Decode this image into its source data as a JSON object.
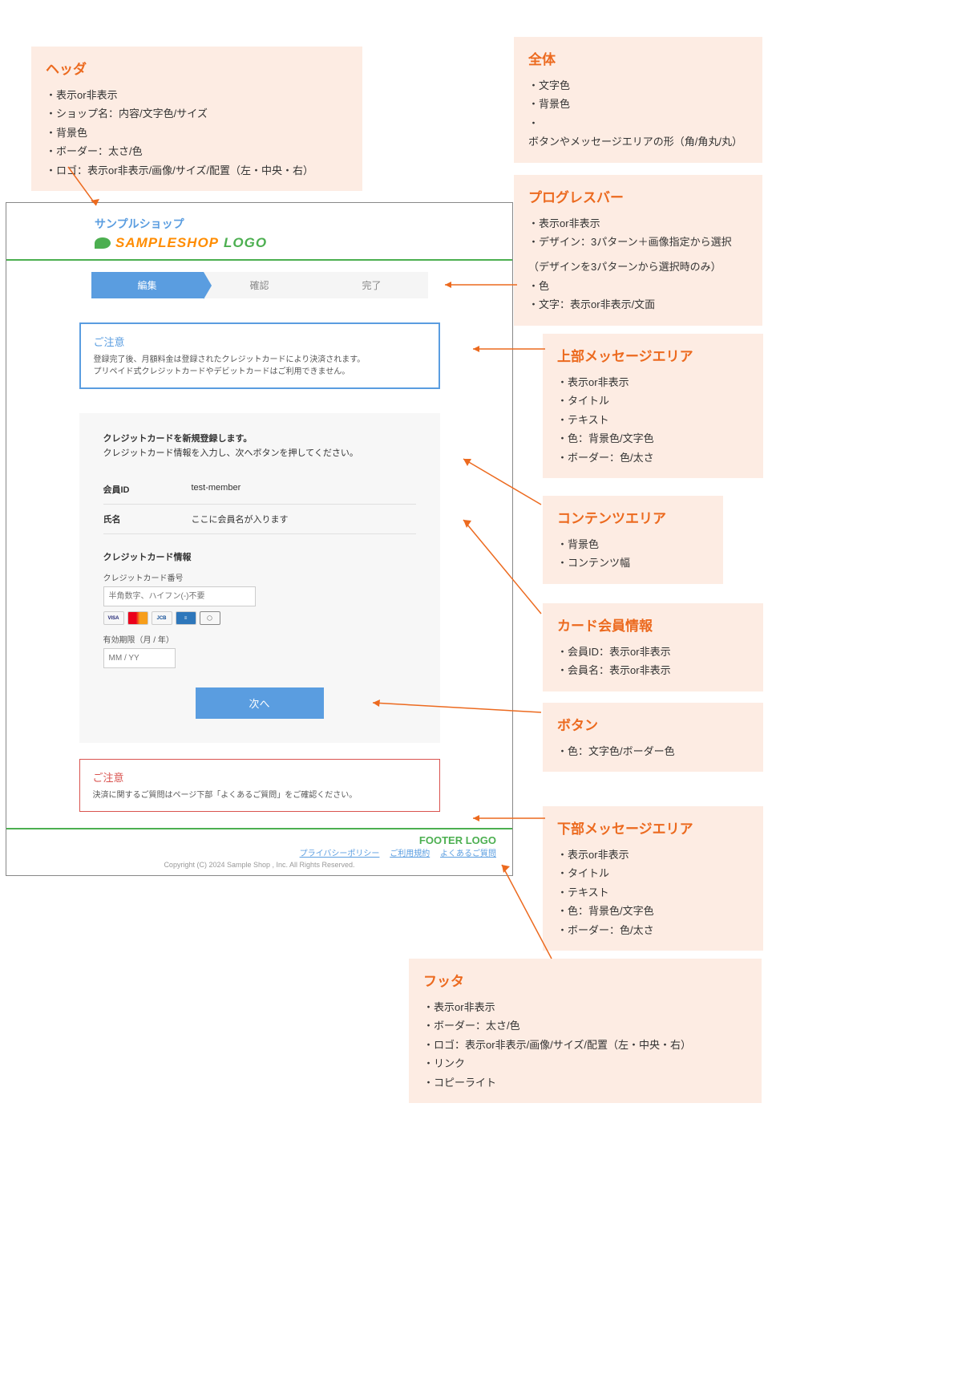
{
  "annotations": {
    "header": {
      "title": "ヘッダ",
      "items": [
        "表示or非表示",
        "ショップ名：内容/文字色/サイズ",
        "背景色",
        "ボーダー：太さ/色",
        "ロゴ：表示or非表示/画像/サイズ/配置（左・中央・右）"
      ]
    },
    "global": {
      "title": "全体",
      "items": [
        "文字色",
        "背景色",
        "ボタンやメッセージエリアの形（角/角丸/丸）"
      ]
    },
    "progress": {
      "title": "プログレスバー",
      "items": [
        "表示or非表示",
        "デザイン：3パターン＋画像指定から選択"
      ],
      "note": "（デザインを3パターンから選択時のみ）",
      "items2": [
        "色",
        "文字：表示or非表示/文面"
      ]
    },
    "uppermsg": {
      "title": "上部メッセージエリア",
      "items": [
        "表示or非表示",
        "タイトル",
        "テキスト",
        "色：背景色/文字色",
        "ボーダー：色/太さ"
      ]
    },
    "content": {
      "title": "コンテンツエリア",
      "items": [
        "背景色",
        "コンテンツ幅"
      ]
    },
    "cardinfo": {
      "title": "カード会員情報",
      "items": [
        "会員ID：表示or非表示",
        "会員名：表示or非表示"
      ]
    },
    "button": {
      "title": "ボタン",
      "items": [
        "色：文字色/ボーダー色"
      ]
    },
    "lowermsg": {
      "title": "下部メッセージエリア",
      "items": [
        "表示or非表示",
        "タイトル",
        "テキスト",
        "色：背景色/文字色",
        "ボーダー：色/太さ"
      ]
    },
    "footer": {
      "title": "フッタ",
      "items": [
        "表示or非表示",
        "ボーダー：太さ/色",
        "ロゴ：表示or非表示/画像/サイズ/配置（左・中央・右）",
        "リンク",
        "コピーライト"
      ]
    }
  },
  "screenshot": {
    "shop_name": "サンプルショップ",
    "logo_text1": "SAMPLESHOP",
    "logo_text2": "LOGO",
    "progress": [
      "編集",
      "確認",
      "完了"
    ],
    "upper_msg": {
      "title": "ご注意",
      "text1": "登録完了後、月額料金は登録されたクレジットカードにより決済されます。",
      "text2": "プリペイド式クレジットカードやデビットカードはご利用できません。"
    },
    "content": {
      "desc1": "クレジットカードを新規登録します。",
      "desc2": "クレジットカード情報を入力し、次へボタンを押してください。",
      "member_id_label": "会員ID",
      "member_id_value": "test-member",
      "name_label": "氏名",
      "name_value": "ここに会員名が入ります",
      "card_section_title": "クレジットカード情報",
      "card_number_label": "クレジットカード番号",
      "card_number_placeholder": "半角数字、ハイフン(-)不要",
      "expiry_label": "有効期限（月 / 年）",
      "expiry_placeholder": "MM / YY",
      "next_button": "次へ"
    },
    "card_brands": {
      "visa": "VISA",
      "mc": "",
      "jcb": "JCB",
      "amex": "≡",
      "diners": "◯"
    },
    "lower_msg": {
      "title": "ご注意",
      "text": "決済に関するご質問はページ下部「よくあるご質問」をご確認ください。"
    },
    "footer": {
      "logo1": "FOOTER",
      "logo2": "LOGO",
      "links": [
        "プライバシーポリシー",
        "ご利用規約",
        "よくあるご質問"
      ],
      "copyright": "Copyright (C) 2024 Sample Shop , Inc. All Rights Reserved."
    }
  }
}
